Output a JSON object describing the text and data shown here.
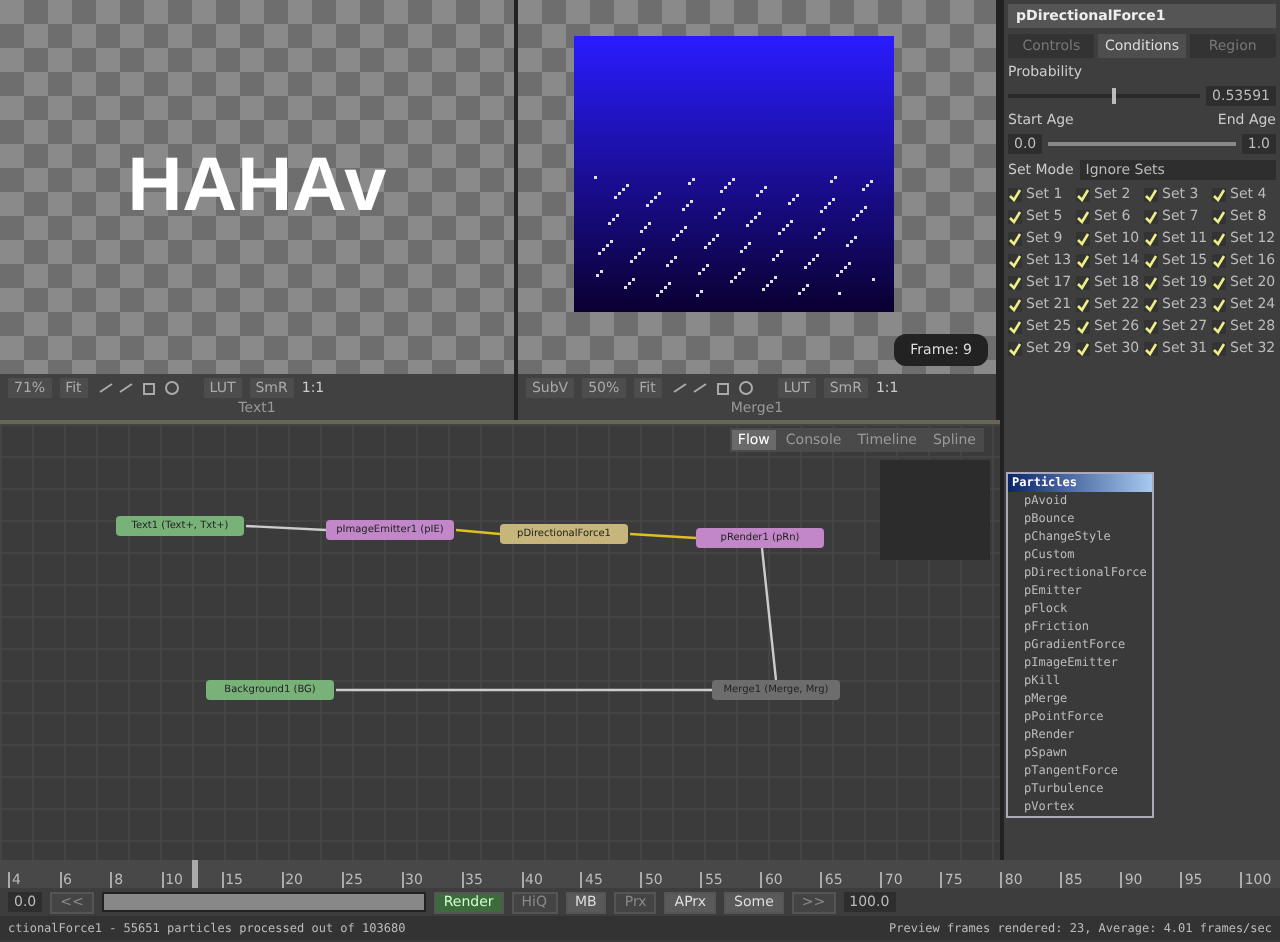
{
  "viewers": [
    {
      "kind": "text",
      "label": "Text1",
      "content": "HAHAv",
      "toolbar": [
        "71%",
        "Fit"
      ],
      "lut": "LUT",
      "smr": "SmR",
      "scale": "1:1"
    },
    {
      "kind": "particles",
      "label": "Merge1",
      "frame": "Frame: 9",
      "toolbar": [
        "SubV",
        "50%",
        "Fit"
      ],
      "lut": "LUT",
      "smr": "SmR",
      "scale": "1:1"
    }
  ],
  "inspector": {
    "title": "pDirectionalForce1",
    "tabs": [
      {
        "label": "Controls",
        "selected": false
      },
      {
        "label": "Conditions",
        "selected": true
      },
      {
        "label": "Region",
        "selected": false
      }
    ],
    "probability": {
      "label": "Probability",
      "level": 0.54,
      "value": "0.53591"
    },
    "age": {
      "start_label": "Start Age",
      "end_label": "End Age",
      "start": "0.0",
      "end": "1.0",
      "level": 1
    },
    "set_mode": {
      "label": "Set Mode",
      "value": "Ignore Sets"
    },
    "sets": [
      {
        "label": "Set 1",
        "checked": true
      },
      {
        "label": "Set 2",
        "checked": true
      },
      {
        "label": "Set 3",
        "checked": true
      },
      {
        "label": "Set 4",
        "checked": true
      },
      {
        "label": "Set 5",
        "checked": true
      },
      {
        "label": "Set 6",
        "checked": true
      },
      {
        "label": "Set 7",
        "checked": true
      },
      {
        "label": "Set 8",
        "checked": true
      },
      {
        "label": "Set 9",
        "checked": true
      },
      {
        "label": "Set 10",
        "checked": true
      },
      {
        "label": "Set 11",
        "checked": true
      },
      {
        "label": "Set 12",
        "checked": true
      },
      {
        "label": "Set 13",
        "checked": true
      },
      {
        "label": "Set 14",
        "checked": true
      },
      {
        "label": "Set 15",
        "checked": true
      },
      {
        "label": "Set 16",
        "checked": true
      },
      {
        "label": "Set 17",
        "checked": true
      },
      {
        "label": "Set 18",
        "checked": true
      },
      {
        "label": "Set 19",
        "checked": true
      },
      {
        "label": "Set 20",
        "checked": true
      },
      {
        "label": "Set 21",
        "checked": true
      },
      {
        "label": "Set 22",
        "checked": true
      },
      {
        "label": "Set 23",
        "checked": true
      },
      {
        "label": "Set 24",
        "checked": true
      },
      {
        "label": "Set 25",
        "checked": true
      },
      {
        "label": "Set 26",
        "checked": true
      },
      {
        "label": "Set 27",
        "checked": true
      },
      {
        "label": "Set 28",
        "checked": true
      },
      {
        "label": "Set 29",
        "checked": true
      },
      {
        "label": "Set 30",
        "checked": true
      },
      {
        "label": "Set 31",
        "checked": true
      },
      {
        "label": "Set 32",
        "checked": true
      }
    ]
  },
  "flow_tabs": [
    {
      "label": "Flow",
      "selected": true
    },
    {
      "label": "Console",
      "selected": false
    },
    {
      "label": "Timeline",
      "selected": false
    },
    {
      "label": "Spline",
      "selected": false
    }
  ],
  "nodes": [
    {
      "label": "Text1 (Text+, Txt+)",
      "kind": "green"
    },
    {
      "label": "pImageEmitter1 (pIE)",
      "kind": "purple"
    },
    {
      "label": "pDirectionalForce1",
      "kind": "tan"
    },
    {
      "label": "pRender1 (pRn)",
      "kind": "purple"
    },
    {
      "label": "Background1 (BG)",
      "kind": "green"
    },
    {
      "label": "Merge1 (Merge, Mrg)",
      "kind": "grey"
    }
  ],
  "particles_menu": {
    "title": "Particles",
    "items": [
      "pAvoid",
      "pBounce",
      "pChangeStyle",
      "pCustom",
      "pDirectionalForce",
      "pEmitter",
      "pFlock",
      "pFriction",
      "pGradientForce",
      "pImageEmitter",
      "pKill",
      "pMerge",
      "pPointForce",
      "pRender",
      "pSpawn",
      "pTangentForce",
      "pTurbulence",
      "pVortex"
    ]
  },
  "timeline": {
    "ticks": [
      "4",
      "6",
      "8",
      "10",
      "15",
      "20",
      "25",
      "30",
      "35",
      "40",
      "45",
      "50",
      "55",
      "60",
      "65",
      "70",
      "75",
      "80",
      "85",
      "90",
      "95",
      "100"
    ],
    "level": 0.15
  },
  "transport": {
    "start": "0.0",
    "back": "<<",
    "range": {
      "level": 1
    },
    "render": "Render",
    "toggles": [
      {
        "label": "HiQ",
        "on": false
      },
      {
        "label": "MB",
        "on": true
      },
      {
        "label": "Prx",
        "on": false
      },
      {
        "label": "APrx",
        "on": true
      },
      {
        "label": "Some",
        "on": true
      }
    ],
    "forward": ">>",
    "end": "100.0"
  },
  "status": {
    "left": "ctionalForce1 - 55651 particles processed out of 103680",
    "right": "Preview frames rendered: 23, Average: 4.01 frames/sec"
  }
}
